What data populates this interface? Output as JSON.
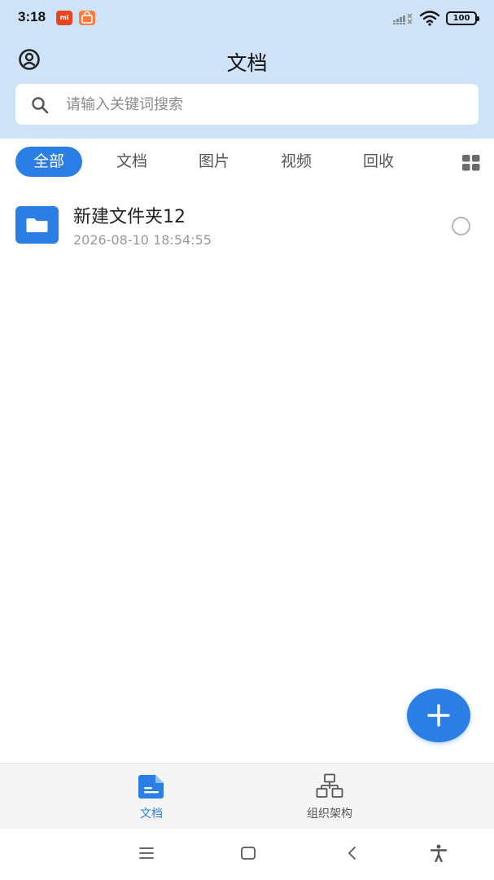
{
  "status_bar": {
    "time": "3:18",
    "battery": "100",
    "app_badges": [
      "mi",
      "shop"
    ]
  },
  "header": {
    "title": "文档",
    "avatar_icon": "user-circle-icon"
  },
  "search": {
    "placeholder": "请输入关键词搜索",
    "value": ""
  },
  "tabs": [
    {
      "label": "全部",
      "active": true
    },
    {
      "label": "文档",
      "active": false
    },
    {
      "label": "图片",
      "active": false
    },
    {
      "label": "视频",
      "active": false
    },
    {
      "label": "回收",
      "active": false
    }
  ],
  "files": [
    {
      "name": "新建文件夹12",
      "date": "2026-08-10 18:54:55",
      "icon": "folder-icon"
    }
  ],
  "fab": {
    "icon": "plus-icon"
  },
  "bottom_nav": [
    {
      "label": "文档",
      "icon": "document-icon",
      "active": true
    },
    {
      "label": "组织架构",
      "icon": "org-chart-icon",
      "active": false
    }
  ],
  "colors": {
    "accent": "#2a7ee4",
    "header_bg": "#cfe3f8",
    "muted_text": "#9a9a9a"
  }
}
